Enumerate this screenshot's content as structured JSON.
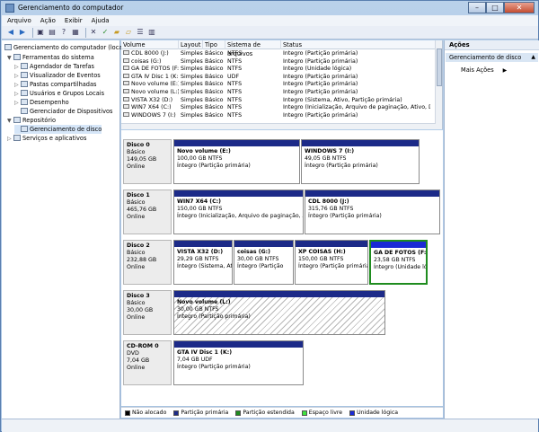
{
  "window": {
    "title": "Gerenciamento do computador"
  },
  "menu": [
    "Arquivo",
    "Ação",
    "Exibir",
    "Ajuda"
  ],
  "tree": [
    {
      "label": "Gerenciamento do computador (local)",
      "level": 0,
      "arrow": ""
    },
    {
      "label": "Ferramentas do sistema",
      "level": 1,
      "arrow": "▼"
    },
    {
      "label": "Agendador de Tarefas",
      "level": 2,
      "arrow": "▷"
    },
    {
      "label": "Visualizador de Eventos",
      "level": 2,
      "arrow": "▷"
    },
    {
      "label": "Pastas compartilhadas",
      "level": 2,
      "arrow": "▷"
    },
    {
      "label": "Usuários e Grupos Locais",
      "level": 2,
      "arrow": "▷"
    },
    {
      "label": "Desempenho",
      "level": 2,
      "arrow": "▷"
    },
    {
      "label": "Gerenciador de Dispositivos",
      "level": 2,
      "arrow": ""
    },
    {
      "label": "Repositório",
      "level": 1,
      "arrow": "▼"
    },
    {
      "label": "Gerenciamento de disco",
      "level": 2,
      "arrow": ""
    },
    {
      "label": "Serviços e aplicativos",
      "level": 1,
      "arrow": "▷"
    }
  ],
  "list": {
    "headers": [
      "Volume",
      "Layout",
      "Tipo",
      "Sistema de arquivos",
      "Status"
    ],
    "rows": [
      [
        "CDL 8000 (J:)",
        "Simples",
        "Básico",
        "NTFS",
        "Íntegro (Partição primária)"
      ],
      [
        "coisas (G:)",
        "Simples",
        "Básico",
        "NTFS",
        "Íntegro (Partição primária)"
      ],
      [
        "GA DE FOTOS (F:)",
        "Simples",
        "Básico",
        "NTFS",
        "Íntegro (Unidade lógica)"
      ],
      [
        "GTA IV Disc 1 (K:)",
        "Simples",
        "Básico",
        "UDF",
        "Íntegro (Partição primária)"
      ],
      [
        "Novo volume (E:)",
        "Simples",
        "Básico",
        "NTFS",
        "Íntegro (Partição primária)"
      ],
      [
        "Novo volume (L:)",
        "Simples",
        "Básico",
        "NTFS",
        "Íntegro (Partição primária)"
      ],
      [
        "VISTA X32 (D:)",
        "Simples",
        "Básico",
        "NTFS",
        "Íntegro (Sistema, Ativo, Partição primária)"
      ],
      [
        "WIN7 X64 (C:)",
        "Simples",
        "Básico",
        "NTFS",
        "Íntegro (Inicialização, Arquivo de paginação, Ativo, Despejo..."
      ],
      [
        "WINDOWS 7 (I:)",
        "Simples",
        "Básico",
        "NTFS",
        "Íntegro (Partição primária)"
      ]
    ]
  },
  "disks": [
    {
      "name": "Disco 0",
      "type": "Básico",
      "size": "149,05 GB",
      "state": "Online",
      "parts": [
        {
          "name": "Novo volume  (E:)",
          "size": "100,00 GB NTFS",
          "status": "Íntegro (Partição primária)"
        },
        {
          "name": "WINDOWS 7  (I:)",
          "size": "49,05 GB NTFS",
          "status": "Íntegro (Partição primária)"
        }
      ]
    },
    {
      "name": "Disco 1",
      "type": "Básico",
      "size": "465,76 GB",
      "state": "Online",
      "parts": [
        {
          "name": "WIN7 X64  (C:)",
          "size": "150,00 GB NTFS",
          "status": "Íntegro (Inicialização, Arquivo de paginação, Ativo"
        },
        {
          "name": "CDL 8000  (J:)",
          "size": "315,76 GB NTFS",
          "status": "Íntegro (Partição primária)"
        }
      ]
    },
    {
      "name": "Disco 2",
      "type": "Básico",
      "size": "232,88 GB",
      "state": "Online",
      "parts": [
        {
          "name": "VISTA X32  (D:)",
          "size": "29,29 GB NTFS",
          "status": "Íntegro (Sistema, Ativ"
        },
        {
          "name": "coisas  (G:)",
          "size": "30,00 GB NTFS",
          "status": "Íntegro (Partição"
        },
        {
          "name": "XP COISAS  (H:)",
          "size": "150,00 GB NTFS",
          "status": "Íntegro (Partição primária)"
        },
        {
          "name": "GA DE FOTOS  (F:)",
          "size": "23,58 GB NTFS",
          "status": "Íntegro (Unidade ló"
        }
      ]
    },
    {
      "name": "Disco 3",
      "type": "Básico",
      "size": "30,00 GB",
      "state": "Online",
      "parts": [
        {
          "name": "Novo volume  (L:)",
          "size": "30,00 GB NTFS",
          "status": "Íntegro (Partição primária)"
        }
      ]
    },
    {
      "name": "CD-ROM 0",
      "type": "DVD",
      "size": "7,04 GB",
      "state": "Online",
      "parts": [
        {
          "name": "GTA IV Disc 1  (K:)",
          "size": "7,04 GB UDF",
          "status": "Íntegro (Partição primária)"
        }
      ]
    }
  ],
  "legend": [
    {
      "label": "Não alocado",
      "color": "#000000"
    },
    {
      "label": "Partição primária",
      "color": "#1c2a88"
    },
    {
      "label": "Partição estendida",
      "color": "#1f8c1f"
    },
    {
      "label": "Espaço livre",
      "color": "#3fe23f"
    },
    {
      "label": "Unidade lógica",
      "color": "#1a2ad6"
    }
  ],
  "actions": {
    "title": "Ações",
    "section": "Gerenciamento de disco",
    "item": "Mais Ações"
  },
  "icons": {
    "collapse_arrow": "▲",
    "expand_arrow": "▶"
  }
}
